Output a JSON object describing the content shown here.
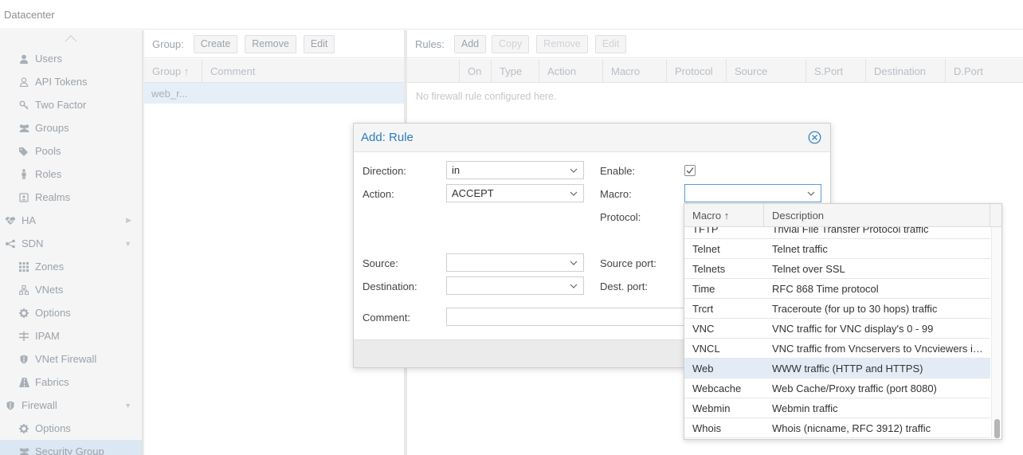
{
  "app": {
    "breadcrumb": "Datacenter"
  },
  "sidebar": {
    "items": [
      {
        "label": "Users",
        "icon": "user-icon"
      },
      {
        "label": "API Tokens",
        "icon": "user-outline-icon"
      },
      {
        "label": "Two Factor",
        "icon": "key-icon"
      },
      {
        "label": "Groups",
        "icon": "users-icon"
      },
      {
        "label": "Pools",
        "icon": "tags-icon"
      },
      {
        "label": "Roles",
        "icon": "male-icon"
      },
      {
        "label": "Realms",
        "icon": "address-book-icon"
      },
      {
        "label": "HA",
        "icon": "heartbeat-icon"
      },
      {
        "label": "SDN",
        "icon": "sdn-icon"
      },
      {
        "label": "Zones",
        "icon": "th-icon"
      },
      {
        "label": "VNets",
        "icon": "network-icon"
      },
      {
        "label": "Options",
        "icon": "gear-icon"
      },
      {
        "label": "IPAM",
        "icon": "ipam-icon"
      },
      {
        "label": "VNet Firewall",
        "icon": "shield-icon"
      },
      {
        "label": "Fabrics",
        "icon": "road-icon"
      },
      {
        "label": "Firewall",
        "icon": "shield-icon"
      },
      {
        "label": "Options",
        "icon": "gear-icon"
      },
      {
        "label": "Security Group",
        "icon": "users-icon"
      }
    ]
  },
  "groups": {
    "toolbar_label": "Group:",
    "buttons": [
      "Create",
      "Remove",
      "Edit"
    ],
    "columns": [
      "Group ↑",
      "Comment"
    ],
    "rows": [
      {
        "group": "web_r..."
      }
    ]
  },
  "rules": {
    "toolbar_label": "Rules:",
    "buttons": [
      "Add",
      "Copy",
      "Remove",
      "Edit"
    ],
    "columns": [
      "On",
      "Type",
      "Action",
      "Macro",
      "Protocol",
      "Source",
      "S.Port",
      "Destination",
      "D.Port"
    ],
    "empty_text": "No firewall rule configured here."
  },
  "dialog": {
    "title": "Add: Rule",
    "direction_label": "Direction:",
    "direction_value": "in",
    "action_label": "Action:",
    "action_value": "ACCEPT",
    "enable_label": "Enable:",
    "enable_checked": true,
    "macro_label": "Macro:",
    "macro_value": "",
    "protocol_label": "Protocol:",
    "source_label": "Source:",
    "source_value": "",
    "destination_label": "Destination:",
    "destination_value": "",
    "source_port_label": "Source port:",
    "dest_port_label": "Dest. port:",
    "comment_label": "Comment:",
    "comment_value": ""
  },
  "macro_list": {
    "columns": [
      "Macro ↑",
      "Description"
    ],
    "rows": [
      {
        "macro": "TFTP",
        "description": "Trivial File Transfer Protocol traffic"
      },
      {
        "macro": "Telnet",
        "description": "Telnet traffic"
      },
      {
        "macro": "Telnets",
        "description": "Telnet over SSL"
      },
      {
        "macro": "Time",
        "description": "RFC 868 Time protocol"
      },
      {
        "macro": "Trcrt",
        "description": "Traceroute (for up to 30 hops) traffic"
      },
      {
        "macro": "VNC",
        "description": "VNC traffic for VNC display's 0 - 99"
      },
      {
        "macro": "VNCL",
        "description": "VNC traffic from Vncservers to Vncviewers in listen mode"
      },
      {
        "macro": "Web",
        "description": "WWW traffic (HTTP and HTTPS)",
        "selected": true
      },
      {
        "macro": "Webcache",
        "description": "Web Cache/Proxy traffic (port 8080)"
      },
      {
        "macro": "Webmin",
        "description": "Webmin traffic"
      },
      {
        "macro": "Whois",
        "description": "Whois (nicname, RFC 3912) traffic"
      }
    ]
  },
  "colors": {
    "accent": "#2e7dbd",
    "selection": "#e3ecf6"
  }
}
